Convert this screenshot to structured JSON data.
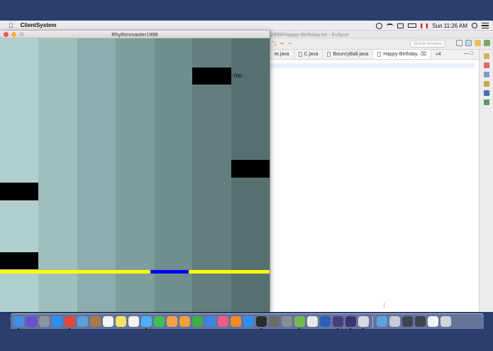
{
  "menubar": {
    "app_name": "ClientSystem",
    "clock": "Sun 11:26 AM",
    "status_icons": [
      "sync-icon",
      "wifi-icon",
      "airplay-icon",
      "battery-icon",
      "flag-icon",
      "spotlight-icon",
      "notification-center-icon"
    ]
  },
  "game_window": {
    "title": "Rhythmmaster1999",
    "lane_colors": [
      "#b2cfd0",
      "#a0bebe",
      "#8fadae",
      "#7e9d9c",
      "#6f8e8d",
      "#627f7e",
      "#567170"
    ],
    "hit_line_color": "#ffff00",
    "hit_highlight_color": "#0000ff",
    "score_label": "-700"
  },
  "eclipse_window": {
    "title": "1999/Happy-Birthday.txt - Eclipse",
    "quick_access_placeholder": "Quick Access",
    "tabs": [
      {
        "label": "te.java",
        "active": false
      },
      {
        "label": "C.java",
        "active": false
      },
      {
        "label": "BouncyBall.java",
        "active": false
      },
      {
        "label": "Happy-Birthday.",
        "active": true
      }
    ],
    "overflow_tabs": "»4"
  },
  "dock": {
    "apps": [
      {
        "name": "finder-icon",
        "color": "#3f8fe6",
        "running": true
      },
      {
        "name": "siri-icon",
        "color": "#6a4fd1",
        "running": false
      },
      {
        "name": "launchpad-icon",
        "color": "#8d95a3",
        "running": false
      },
      {
        "name": "safari-icon",
        "color": "#2d8ef0",
        "running": false
      },
      {
        "name": "chrome-icon",
        "color": "#e5453a",
        "running": true
      },
      {
        "name": "preview-icon",
        "color": "#5aa0d9",
        "running": false
      },
      {
        "name": "notes-brown-icon",
        "color": "#a77b45",
        "running": false
      },
      {
        "name": "calendar-icon",
        "color": "#f4f4f4",
        "running": false
      },
      {
        "name": "notes-icon",
        "color": "#f6e26b",
        "running": false
      },
      {
        "name": "reminders-icon",
        "color": "#f2f2f2",
        "running": false
      },
      {
        "name": "messages-icon",
        "color": "#4ab2f3",
        "running": true
      },
      {
        "name": "facetime-icon",
        "color": "#3fbf55",
        "running": false
      },
      {
        "name": "photos-icon",
        "color": "#f3a24b",
        "running": false
      },
      {
        "name": "pages-icon",
        "color": "#f0a03a",
        "running": false
      },
      {
        "name": "numbers-icon",
        "color": "#39b14a",
        "running": false
      },
      {
        "name": "keynote-icon",
        "color": "#3a86e6",
        "running": false
      },
      {
        "name": "itunes-icon",
        "color": "#f05b8a",
        "running": false
      },
      {
        "name": "ibooks-icon",
        "color": "#f08a2b",
        "running": false
      },
      {
        "name": "app-store-icon",
        "color": "#2f8ff0",
        "running": false
      },
      {
        "name": "terminal-icon",
        "color": "#2b2b2b",
        "running": true
      },
      {
        "name": "archive-icon",
        "color": "#6b6b6b",
        "running": false
      },
      {
        "name": "system-preferences-icon",
        "color": "#8a8f97",
        "running": false
      },
      {
        "name": "android-studio-icon",
        "color": "#77b852",
        "running": true
      },
      {
        "name": "text-editor-icon",
        "color": "#e8e8e8",
        "running": false
      },
      {
        "name": "word-icon",
        "color": "#2b5fb8",
        "running": false
      },
      {
        "name": "github-icon",
        "color": "#4a3d7a",
        "running": true
      },
      {
        "name": "eclipse-icon",
        "color": "#3b3470",
        "running": true
      },
      {
        "name": "java-icon",
        "color": "#d9d9e6",
        "running": true
      },
      {
        "name": "downloads-folder-icon",
        "color": "#5aa4e0",
        "running": false
      },
      {
        "name": "screenshot-icon",
        "color": "#c7ccd6",
        "running": false
      },
      {
        "name": "screen-1-icon",
        "color": "#3e4450",
        "running": false
      },
      {
        "name": "screen-2-icon",
        "color": "#3e4450",
        "running": false
      },
      {
        "name": "screen-3-icon",
        "color": "#f4f4f4",
        "running": false
      },
      {
        "name": "trash-icon",
        "color": "#d2d6dc",
        "running": false
      }
    ]
  }
}
